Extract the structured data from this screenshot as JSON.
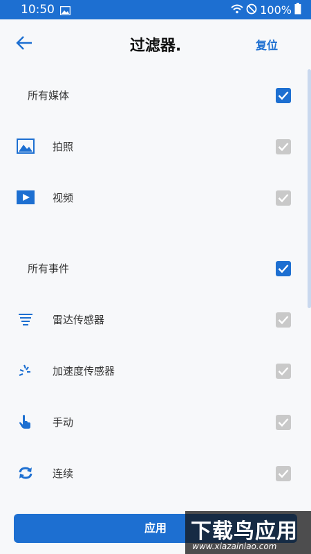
{
  "status_bar": {
    "time": "10:50",
    "battery": "100%"
  },
  "header": {
    "title": "过滤器.",
    "reset_label": "复位"
  },
  "sections": [
    {
      "label": "所有媒体",
      "checked": true
    },
    {
      "label": "所有事件",
      "checked": true
    }
  ],
  "media_items": [
    {
      "label": "拍照",
      "icon": "photo-icon"
    },
    {
      "label": "视频",
      "icon": "video-icon"
    }
  ],
  "event_items": [
    {
      "label": "雷达传感器",
      "icon": "radar-icon"
    },
    {
      "label": "加速度传感器",
      "icon": "accelerometer-icon"
    },
    {
      "label": "手动",
      "icon": "hand-pointer-icon"
    },
    {
      "label": "连续",
      "icon": "loop-icon"
    }
  ],
  "apply_label": "应用",
  "watermark": {
    "main": "下载鸟应用",
    "sub": "www.xiazainiao.com"
  },
  "colors": {
    "accent": "#1d6fd1",
    "disabled": "#c9c9c9"
  }
}
